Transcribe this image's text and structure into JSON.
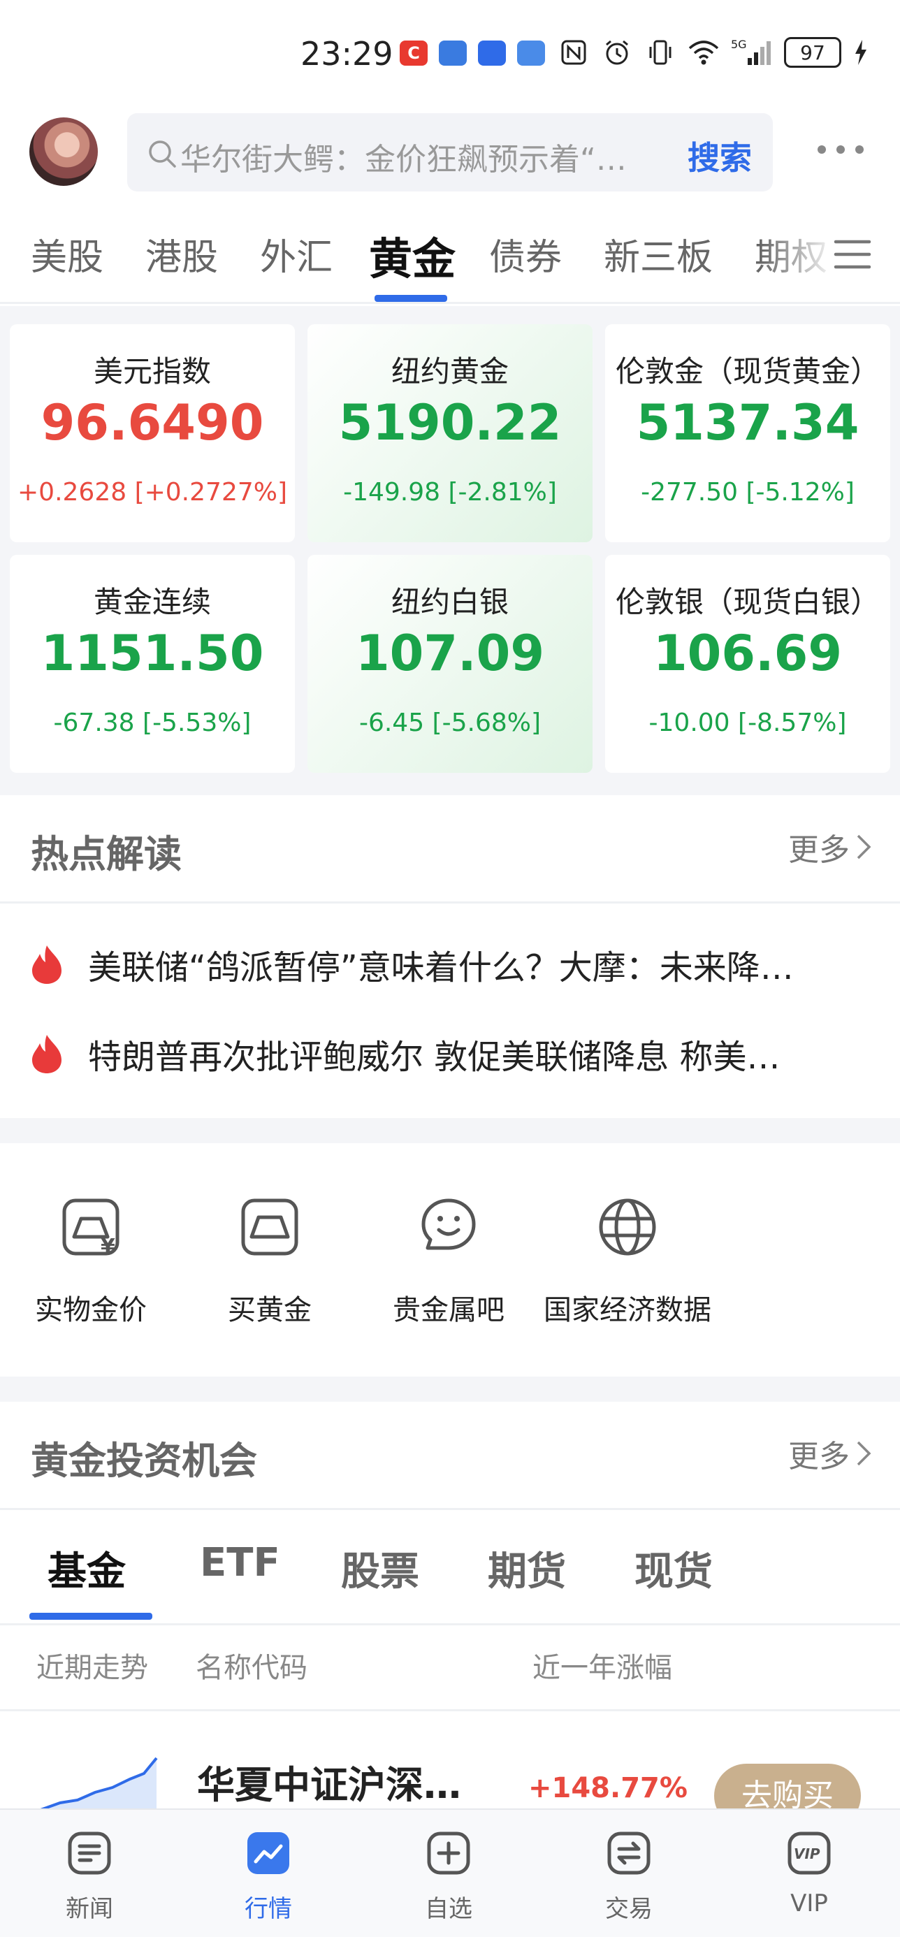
{
  "status_bar": {
    "time": "23:29",
    "battery": "97",
    "network": "5G",
    "apps": [
      "C",
      "",
      "",
      ""
    ]
  },
  "header": {
    "search_placeholder": "华尔街大鳄：金价狂飙预示着“…",
    "search_button": "搜索"
  },
  "tabs": [
    {
      "label": "美股"
    },
    {
      "label": "港股"
    },
    {
      "label": "外汇"
    },
    {
      "label": "黄金",
      "active": true
    },
    {
      "label": "债券"
    },
    {
      "label": "新三板"
    },
    {
      "label": "期权"
    }
  ],
  "quotes": [
    {
      "name": "美元指数",
      "value": "96.6490",
      "change": "+0.2628 [+0.2727%]",
      "direction": "up"
    },
    {
      "name": "纽约黄金",
      "value": "5190.22",
      "change": "-149.98 [-2.81%]",
      "direction": "down"
    },
    {
      "name": "伦敦金（现货黄金）",
      "value": "5137.34",
      "change": "-277.50 [-5.12%]",
      "direction": "down"
    },
    {
      "name": "黄金连续",
      "value": "1151.50",
      "change": "-67.38 [-5.53%]",
      "direction": "down"
    },
    {
      "name": "纽约白银",
      "value": "107.09",
      "change": "-6.45 [-5.68%]",
      "direction": "down"
    },
    {
      "name": "伦敦银（现货白银）",
      "value": "106.69",
      "change": "-10.00 [-8.57%]",
      "direction": "down"
    }
  ],
  "hot": {
    "title": "热点解读",
    "more": "更多",
    "items": [
      "美联储“鸽派暂停”意味着什么？大摩：未来降…",
      "特朗普再次批评鲍威尔 敦促美联储降息 称美…"
    ]
  },
  "shortcuts": [
    {
      "label": "实物金价",
      "icon": "physical-gold-price-icon"
    },
    {
      "label": "买黄金",
      "icon": "buy-gold-icon"
    },
    {
      "label": "贵金属吧",
      "icon": "forum-chat-icon"
    },
    {
      "label": "国家经济数据",
      "icon": "globe-icon"
    }
  ],
  "invest": {
    "title": "黄金投资机会",
    "more": "更多",
    "tabs": [
      "基金",
      "ETF",
      "股票",
      "期货",
      "现货"
    ],
    "columns": {
      "trend": "近期走势",
      "name": "名称代码",
      "change": "近一年涨幅"
    },
    "rows": [
      {
        "name": "华夏中证沪深…",
        "change": "+148.77%",
        "action": "去购买"
      }
    ]
  },
  "bottom_nav": [
    {
      "label": "新闻",
      "icon": "news-icon"
    },
    {
      "label": "行情",
      "icon": "market-icon",
      "active": true
    },
    {
      "label": "自选",
      "icon": "watchlist-add-icon"
    },
    {
      "label": "交易",
      "icon": "trade-icon"
    },
    {
      "label": "VIP",
      "icon": "vip-icon"
    }
  ],
  "colors": {
    "accent": "#2f6be8",
    "up": "#e84a3f",
    "down": "#1aa34a",
    "buy_button": "#c9b08e"
  }
}
